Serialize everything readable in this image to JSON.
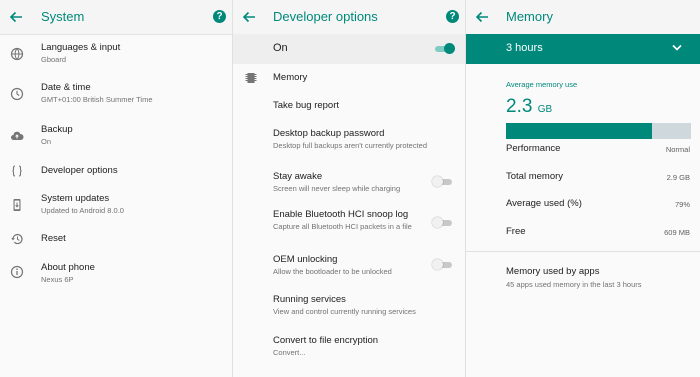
{
  "system": {
    "title": "System",
    "items": [
      {
        "title": "Languages & input",
        "subtitle": "Gboard",
        "icon": "globe-icon"
      },
      {
        "title": "Date & time",
        "subtitle": "GMT+01:00 British Summer Time",
        "icon": "clock-icon"
      },
      {
        "title": "Backup",
        "subtitle": "On",
        "icon": "cloud-upload-icon"
      },
      {
        "title": "Developer options",
        "subtitle": "",
        "icon": "code-braces-icon"
      },
      {
        "title": "System updates",
        "subtitle": "Updated to Android 8.0.0",
        "icon": "phone-update-icon"
      },
      {
        "title": "Reset",
        "subtitle": "",
        "icon": "history-icon"
      },
      {
        "title": "About phone",
        "subtitle": "Nexus 6P",
        "icon": "info-icon"
      }
    ]
  },
  "developer": {
    "title": "Developer options",
    "master_label": "On",
    "master_on": true,
    "items": [
      {
        "title": "Memory",
        "subtitle": ""
      },
      {
        "title": "Take bug report",
        "subtitle": ""
      },
      {
        "title": "Desktop backup password",
        "subtitle": "Desktop full backups aren't currently protected"
      },
      {
        "title": "Stay awake",
        "subtitle": "Screen will never sleep while charging",
        "toggle": false
      },
      {
        "title": "Enable Bluetooth HCI snoop log",
        "subtitle": "Capture all Bluetooth HCI packets in a file",
        "toggle": false
      },
      {
        "title": "OEM unlocking",
        "subtitle": "Allow the bootloader to be unlocked",
        "toggle": false
      },
      {
        "title": "Running services",
        "subtitle": "View and control currently running services"
      },
      {
        "title": "Convert to file encryption",
        "subtitle": "Convert..."
      }
    ]
  },
  "memory": {
    "title": "Memory",
    "period": "3 hours",
    "average_label": "Average memory use",
    "average_value": "2.3",
    "average_unit": "GB",
    "usage_fraction": 0.79,
    "stats": [
      {
        "label": "Performance",
        "value": "Normal"
      },
      {
        "label": "Total memory",
        "value": "2.9 GB"
      },
      {
        "label": "Average used (%)",
        "value": "79%"
      },
      {
        "label": "Free",
        "value": "609 MB"
      }
    ],
    "apps_title": "Memory used by apps",
    "apps_subtitle": "45 apps used memory in the last 3 hours"
  },
  "colors": {
    "accent": "#00897b",
    "bar_track": "#cfd8dc"
  },
  "help_glyph": "?"
}
